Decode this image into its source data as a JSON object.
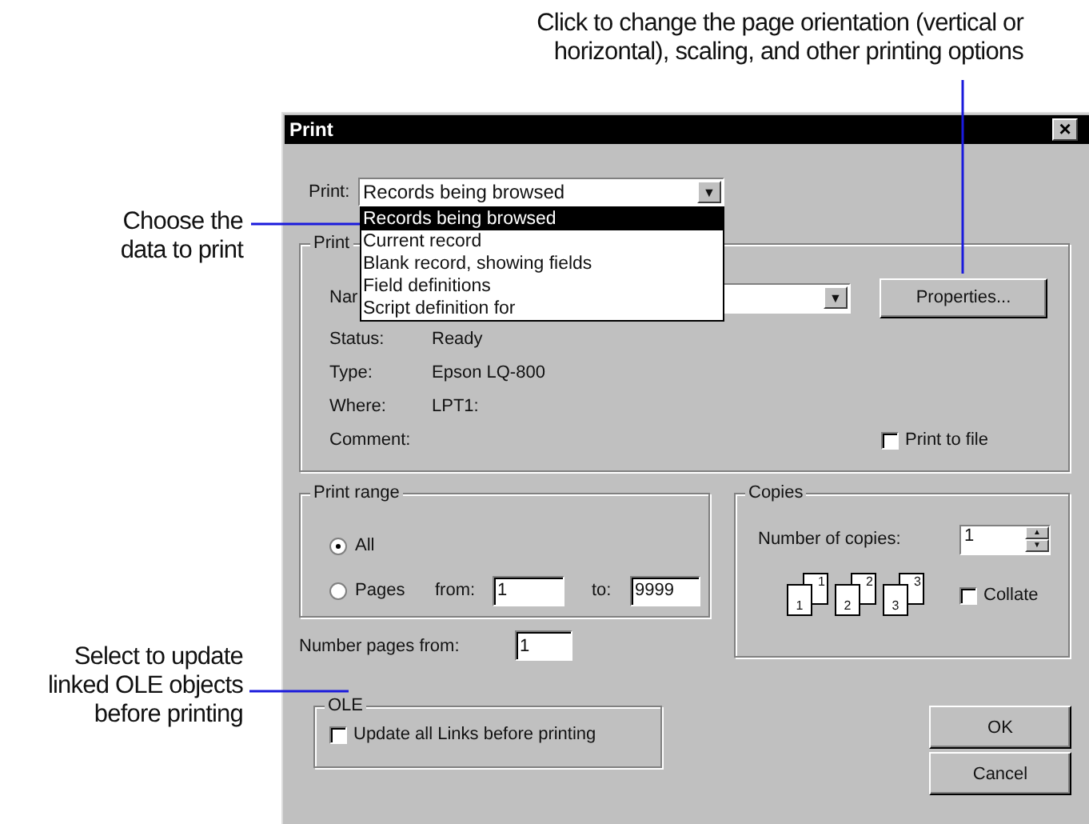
{
  "callouts": {
    "properties": [
      "Click to change the page orientation (vertical or",
      "horizontal), scaling, and other printing options"
    ],
    "print_choice": [
      "Choose the",
      "data to print"
    ],
    "ole": [
      "Select to update",
      "linked OLE objects",
      "before printing"
    ]
  },
  "window": {
    "title": "Print",
    "close": "×"
  },
  "print": {
    "label": "Print:",
    "value": "Records being browsed",
    "arrow": "▼",
    "options": [
      {
        "label": "Records being browsed",
        "selected": true
      },
      {
        "label": "Current record",
        "selected": false
      },
      {
        "label": "Blank record, showing fields",
        "selected": false
      },
      {
        "label": "Field definitions",
        "selected": false
      },
      {
        "label": "Script definition for",
        "selected": false
      }
    ]
  },
  "printer": {
    "group": "Print",
    "name_label": "Nar",
    "arrow": "▼",
    "properties": "Properties...",
    "info": [
      {
        "label": "Status:",
        "value": "Ready"
      },
      {
        "label": "Type:",
        "value": "Epson LQ-800"
      },
      {
        "label": "Where:",
        "value": "LPT1:"
      },
      {
        "label": "Comment:"
      }
    ],
    "print_to_file": {
      "label": "Print to file",
      "checked": false
    }
  },
  "print_range": {
    "group": "Print range",
    "all": {
      "label": "All",
      "selected": true
    },
    "pages": {
      "label": "Pages",
      "selected": false
    },
    "from_label": "from:",
    "from": "1",
    "to_label": "to:",
    "to": "9999"
  },
  "number_pages": {
    "label": "Number pages from:",
    "value": "1"
  },
  "copies": {
    "group": "Copies",
    "label": "Number of copies:",
    "value": "1",
    "up": "▲",
    "down": "▼",
    "pages": [
      {
        "back": "1",
        "front": "1"
      },
      {
        "back": "2",
        "front": "2"
      },
      {
        "back": "3",
        "front": "3"
      }
    ],
    "collate": {
      "label": "Collate",
      "checked": false
    }
  },
  "ole": {
    "group": "OLE",
    "update": {
      "label": "Update all Links before printing",
      "checked": false
    }
  },
  "buttons": [
    "OK",
    "Cancel"
  ]
}
